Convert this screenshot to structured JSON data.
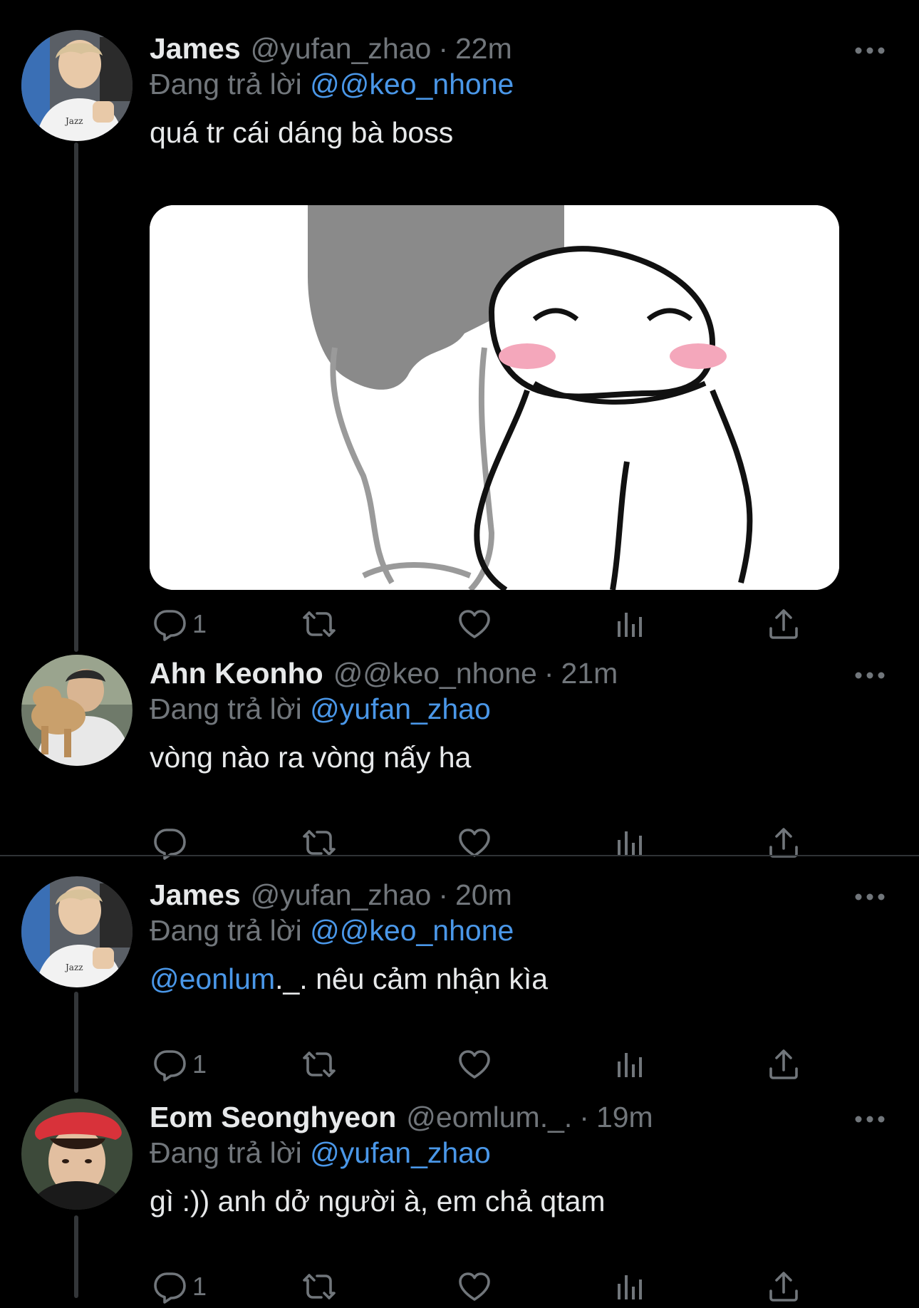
{
  "colors": {
    "background": "#000000",
    "primary_text": "#e7e9ea",
    "secondary_text": "#71767b",
    "mention": "#4a97e8",
    "thread_line": "#333639"
  },
  "tweets": [
    {
      "name": "James",
      "handle": "@yufan_zhao",
      "separator": "·",
      "time": "22m",
      "reply_prefix": "Đang trả lời",
      "reply_to": "@@keo_nhone",
      "text": "quá tr cái dáng bà boss",
      "reply_count": "1",
      "has_media": true,
      "media_description": "meme-image"
    },
    {
      "name": "Ahn Keonho",
      "handle": "@@keo_nhone",
      "separator": "·",
      "time": "21m",
      "reply_prefix": "Đang trả lời",
      "reply_to": "@yufan_zhao",
      "text": "vòng nào ra vòng nấy ha",
      "reply_count": ""
    },
    {
      "name": "James",
      "handle": "@yufan_zhao",
      "separator": "·",
      "time": "20m",
      "reply_prefix": "Đang trả lời",
      "reply_to": "@@keo_nhone",
      "text_mention": "@eonlum",
      "text_rest": "._. nêu cảm nhận kìa",
      "reply_count": "1"
    },
    {
      "name": "Eom Seonghyeon",
      "handle": "@eomlum._.",
      "separator": "·",
      "time": "19m",
      "reply_prefix": "Đang trả lời",
      "reply_to": "@yufan_zhao",
      "text": "gì :)) anh dở người à, em chả qtam",
      "reply_count": "1"
    }
  ],
  "icons": {
    "more": "more-horizontal-icon",
    "reply": "reply-icon",
    "retweet": "retweet-icon",
    "like": "heart-icon",
    "views": "views-icon",
    "share": "share-icon"
  }
}
